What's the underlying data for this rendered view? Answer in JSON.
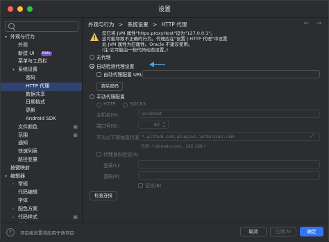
{
  "window": {
    "title": "设置"
  },
  "search": {
    "placeholder": ""
  },
  "sidebar": {
    "items": [
      {
        "label": "外观与行为",
        "level": 0,
        "arrow": "▾",
        "selected": false,
        "gear": false,
        "badge": ""
      },
      {
        "label": "外观",
        "level": 1,
        "arrow": "",
        "selected": false,
        "gear": false,
        "badge": ""
      },
      {
        "label": "新建 UI",
        "level": 1,
        "arrow": "",
        "selected": false,
        "gear": false,
        "badge": "Beta"
      },
      {
        "label": "菜单与工具栏",
        "level": 1,
        "arrow": "",
        "selected": false,
        "gear": false,
        "badge": ""
      },
      {
        "label": "系统设置",
        "level": 1,
        "arrow": "▾",
        "selected": false,
        "gear": false,
        "badge": ""
      },
      {
        "label": "密码",
        "level": 2,
        "arrow": "",
        "selected": false,
        "gear": false,
        "badge": ""
      },
      {
        "label": "HTTP 代理",
        "level": 2,
        "arrow": "",
        "selected": true,
        "gear": false,
        "badge": ""
      },
      {
        "label": "数据共享",
        "level": 2,
        "arrow": "",
        "selected": false,
        "gear": false,
        "badge": ""
      },
      {
        "label": "日期格式",
        "level": 2,
        "arrow": "",
        "selected": false,
        "gear": false,
        "badge": ""
      },
      {
        "label": "更新",
        "level": 2,
        "arrow": "",
        "selected": false,
        "gear": false,
        "badge": ""
      },
      {
        "label": "Android SDK",
        "level": 2,
        "arrow": "",
        "selected": false,
        "gear": false,
        "badge": ""
      },
      {
        "label": "文件颜色",
        "level": 1,
        "arrow": "",
        "selected": false,
        "gear": true,
        "badge": ""
      },
      {
        "label": "范围",
        "level": 1,
        "arrow": "",
        "selected": false,
        "gear": true,
        "badge": ""
      },
      {
        "label": "通知",
        "level": 1,
        "arrow": "",
        "selected": false,
        "gear": false,
        "badge": ""
      },
      {
        "label": "快速列表",
        "level": 1,
        "arrow": "",
        "selected": false,
        "gear": false,
        "badge": ""
      },
      {
        "label": "路径变量",
        "level": 1,
        "arrow": "",
        "selected": false,
        "gear": false,
        "badge": ""
      },
      {
        "label": "按键映射",
        "level": 0,
        "arrow": "",
        "selected": false,
        "gear": false,
        "badge": ""
      },
      {
        "label": "编辑器",
        "level": 0,
        "arrow": "▾",
        "selected": false,
        "gear": false,
        "badge": ""
      },
      {
        "label": "常规",
        "level": 1,
        "arrow": "›",
        "selected": false,
        "gear": false,
        "badge": ""
      },
      {
        "label": "代码编辑",
        "level": 1,
        "arrow": "",
        "selected": false,
        "gear": false,
        "badge": ""
      },
      {
        "label": "字体",
        "level": 1,
        "arrow": "",
        "selected": false,
        "gear": false,
        "badge": ""
      },
      {
        "label": "配色方案",
        "level": 1,
        "arrow": "›",
        "selected": false,
        "gear": false,
        "badge": ""
      },
      {
        "label": "代码样式",
        "level": 1,
        "arrow": "›",
        "selected": false,
        "gear": true,
        "badge": ""
      },
      {
        "label": "检查",
        "level": 1,
        "arrow": "",
        "selected": false,
        "gear": true,
        "badge": ""
      },
      {
        "label": "文件和代码模板",
        "level": 1,
        "arrow": "",
        "selected": false,
        "gear": true,
        "badge": ""
      }
    ]
  },
  "breadcrumb": {
    "part1": "外观与行为",
    "sep": ">",
    "part2": "系统设置",
    "part3": "HTTP 代理"
  },
  "warning": {
    "line1": "您已将 JVM 属性\"https.proxyHost\"设为\"127.0.0.1\"。",
    "line2": "这可能导致不正确的行为。代理应在\"设置 | HTTP 代理\"中设置",
    "line3": "此 JVM 属性为旧属性。Oracle 不建议使用。",
    "line4": "(注:它可能由一些代码动态设置。)"
  },
  "proxy": {
    "no_proxy": "无代理",
    "auto_detect": "自动检测代理设置",
    "auto_config_url": "自动代理配置 URL:",
    "clear_passwords": "清除密码",
    "manual": "手动代理配置",
    "http": "HTTP",
    "socks": "SOCKS",
    "host_label": "主机名(H):",
    "host_value": "localhost",
    "port_label": "端口号(N):",
    "port_value": "80",
    "no_proxy_for_label": "不为以下项使用代理(F):",
    "no_proxy_for_value": "*.github.com,plugins.jetbrains.com",
    "example": "示例: *.domain.com、192.168.*",
    "proxy_auth": "代理身份验证(A)",
    "login_label": "登录(L):",
    "password_label": "密码(P):",
    "remember": "记住(B)",
    "check_connection": "检查连接"
  },
  "footer": {
    "help": "?",
    "text": "项目级设置将应用于新项目",
    "cancel": "取消",
    "apply": "应用(A)",
    "ok": "确定"
  },
  "colors": {
    "accent": "#3574f0",
    "selection": "#2e436e",
    "hint_arrow": "#4aa3df",
    "warning": "#f2c55c"
  }
}
